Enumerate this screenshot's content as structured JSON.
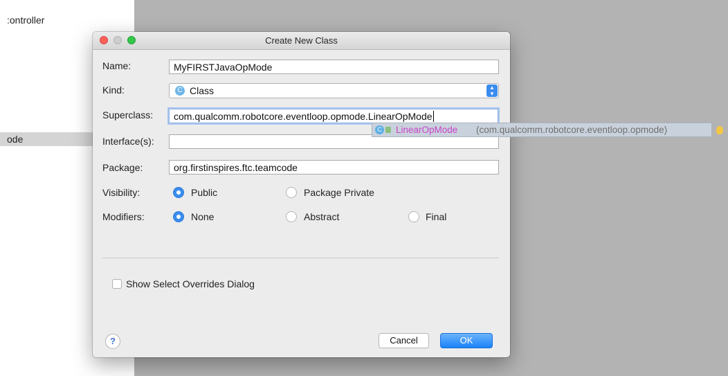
{
  "background": {
    "left_text": ":ontroller",
    "left_row_text": "ode"
  },
  "dialog": {
    "title": "Create New Class",
    "name_label": "Name:",
    "name_value": "MyFIRSTJavaOpMode",
    "kind_label": "Kind:",
    "kind_value": "Class",
    "kind_icon": "C",
    "superclass_label": "Superclass:",
    "superclass_value": "com.qualcomm.robotcore.eventloop.opmode.LinearOpMode",
    "interfaces_label": "Interface(s):",
    "interfaces_value": "",
    "package_label": "Package:",
    "package_value": "org.firstinspires.ftc.teamcode",
    "visibility_label": "Visibility:",
    "visibility_options": [
      {
        "label": "Public",
        "selected": true
      },
      {
        "label": "Package Private",
        "selected": false
      }
    ],
    "modifiers_label": "Modifiers:",
    "modifier_options": [
      {
        "label": "None",
        "selected": true
      },
      {
        "label": "Abstract",
        "selected": false
      },
      {
        "label": "Final",
        "selected": false
      }
    ],
    "show_overrides_label": "Show Select Overrides Dialog",
    "show_overrides_checked": false,
    "help_label": "?",
    "cancel_label": "Cancel",
    "ok_label": "OK"
  },
  "autocomplete": {
    "icon": "C",
    "class_name": "LinearOpMode",
    "package": "(com.qualcomm.robotcore.eventloop.opmode)"
  },
  "colors": {
    "accent": "#3a8dee",
    "autocomplete_name": "#c944c9",
    "window_close": "#fc605b",
    "window_zoom": "#34c84a"
  }
}
